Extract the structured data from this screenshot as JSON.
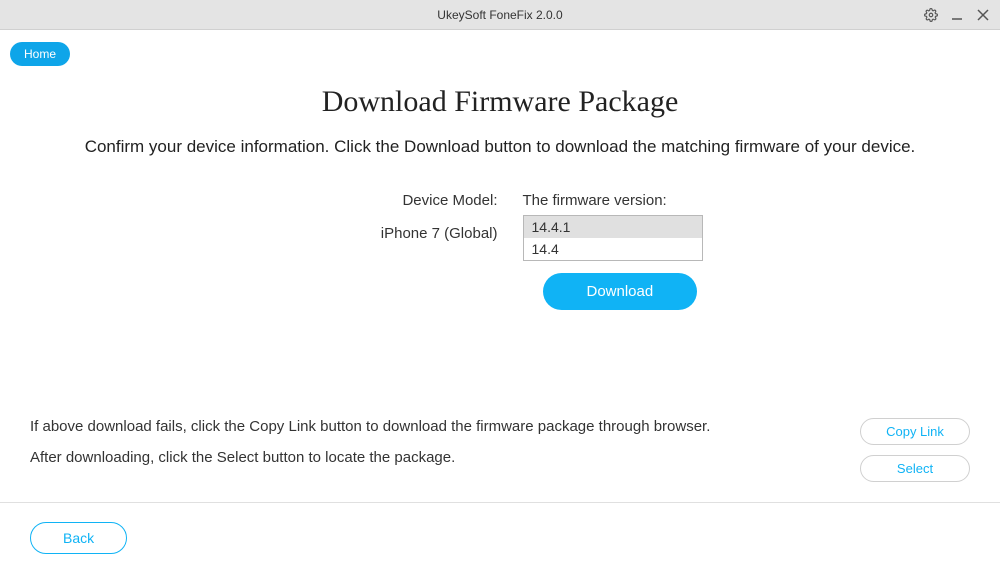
{
  "titlebar": {
    "title": "UkeySoft FoneFix 2.0.0"
  },
  "nav": {
    "home_label": "Home"
  },
  "main": {
    "heading": "Download Firmware Package",
    "subtitle": "Confirm your device information. Click the Download button to download the matching firmware of your device.",
    "device_model_label": "Device Model:",
    "device_model_value": "iPhone 7 (Global)",
    "firmware_version_label": "The firmware version:",
    "firmware_options": [
      "14.4.1",
      "14.4"
    ],
    "firmware_selected": "14.4.1",
    "download_label": "Download"
  },
  "bottom": {
    "text1": "If above download fails, click the Copy Link button to download the firmware package through browser.",
    "text2": "After downloading, click the Select button to locate the package.",
    "copy_link_label": "Copy Link",
    "select_label": "Select"
  },
  "footer": {
    "back_label": "Back"
  }
}
